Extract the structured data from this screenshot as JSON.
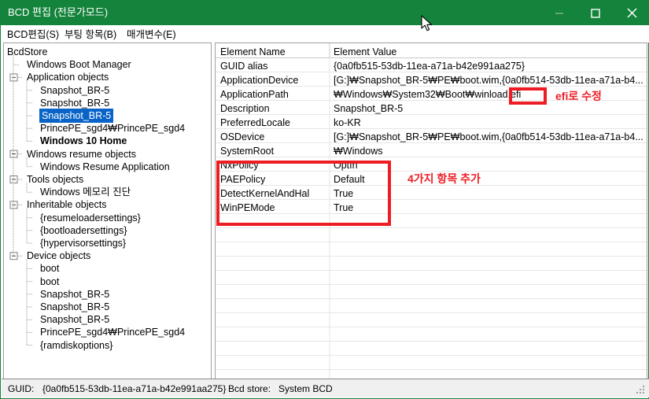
{
  "window": {
    "title": "BCD 편집 (전문가모드)",
    "accent_color": "#14833b",
    "controls": {
      "minimize": "minimize-icon",
      "maximize": "maximize-icon",
      "close": "close-icon"
    }
  },
  "menubar": {
    "items": [
      {
        "label": "BCD편집(S)"
      },
      {
        "label": "부팅 항목(B)"
      },
      {
        "label": "매개변수(E)"
      }
    ]
  },
  "tree": {
    "root": "BcdStore",
    "nodes": [
      {
        "label": "BcdStore",
        "depth": 0,
        "expander": "none",
        "bold": false,
        "selected": false
      },
      {
        "label": "Windows Boot Manager",
        "depth": 1,
        "expander": "none",
        "bold": false,
        "selected": false
      },
      {
        "label": "Application objects",
        "depth": 1,
        "expander": "minus",
        "bold": false,
        "selected": false
      },
      {
        "label": "Snapshot_BR-5",
        "depth": 2,
        "expander": "none",
        "bold": false,
        "selected": false
      },
      {
        "label": "Snapshot_BR-5",
        "depth": 2,
        "expander": "none",
        "bold": false,
        "selected": false
      },
      {
        "label": "Snapshot_BR-5",
        "depth": 2,
        "expander": "none",
        "bold": false,
        "selected": true
      },
      {
        "label": "PrincePE_sgd4₩PrincePE_sgd4",
        "depth": 2,
        "expander": "none",
        "bold": false,
        "selected": false
      },
      {
        "label": "Windows 10 Home",
        "depth": 2,
        "expander": "none",
        "bold": true,
        "selected": false
      },
      {
        "label": "Windows resume objects",
        "depth": 1,
        "expander": "minus",
        "bold": false,
        "selected": false
      },
      {
        "label": "Windows Resume Application",
        "depth": 2,
        "expander": "none",
        "bold": false,
        "selected": false
      },
      {
        "label": "Tools objects",
        "depth": 1,
        "expander": "minus",
        "bold": false,
        "selected": false
      },
      {
        "label": "Windows 메모리 진단",
        "depth": 2,
        "expander": "none",
        "bold": false,
        "selected": false
      },
      {
        "label": "Inheritable objects",
        "depth": 1,
        "expander": "minus",
        "bold": false,
        "selected": false
      },
      {
        "label": "{resumeloadersettings}",
        "depth": 2,
        "expander": "none",
        "bold": false,
        "selected": false
      },
      {
        "label": "{bootloadersettings}",
        "depth": 2,
        "expander": "none",
        "bold": false,
        "selected": false
      },
      {
        "label": "{hypervisorsettings}",
        "depth": 2,
        "expander": "none",
        "bold": false,
        "selected": false
      },
      {
        "label": "Device objects",
        "depth": 1,
        "expander": "minus",
        "bold": false,
        "selected": false
      },
      {
        "label": "boot",
        "depth": 2,
        "expander": "none",
        "bold": false,
        "selected": false
      },
      {
        "label": "boot",
        "depth": 2,
        "expander": "none",
        "bold": false,
        "selected": false
      },
      {
        "label": "Snapshot_BR-5",
        "depth": 2,
        "expander": "none",
        "bold": false,
        "selected": false
      },
      {
        "label": "Snapshot_BR-5",
        "depth": 2,
        "expander": "none",
        "bold": false,
        "selected": false
      },
      {
        "label": "Snapshot_BR-5",
        "depth": 2,
        "expander": "none",
        "bold": false,
        "selected": false
      },
      {
        "label": "PrincePE_sgd4₩PrincePE_sgd4",
        "depth": 2,
        "expander": "none",
        "bold": false,
        "selected": false
      },
      {
        "label": "{ramdiskoptions}",
        "depth": 2,
        "expander": "none",
        "bold": false,
        "selected": false
      }
    ]
  },
  "list": {
    "columns": [
      {
        "label": "Element Name"
      },
      {
        "label": "Element Value"
      }
    ],
    "rows": [
      {
        "name": "GUID alias",
        "value": "{0a0fb515-53db-11ea-a71a-b42e991aa275}"
      },
      {
        "name": "ApplicationDevice",
        "value": "[G:]₩Snapshot_BR-5₩PE₩boot.wim,{0a0fb514-53db-11ea-a71a-b4..."
      },
      {
        "name": "ApplicationPath",
        "value": "₩Windows₩System32₩Boot₩winload.efi"
      },
      {
        "name": "Description",
        "value": "Snapshot_BR-5"
      },
      {
        "name": "PreferredLocale",
        "value": "ko-KR"
      },
      {
        "name": "OSDevice",
        "value": "[G:]₩Snapshot_BR-5₩PE₩boot.wim,{0a0fb514-53db-11ea-a71a-b4..."
      },
      {
        "name": "SystemRoot",
        "value": "₩Windows"
      },
      {
        "name": "NxPolicy",
        "value": "OptIn"
      },
      {
        "name": "PAEPolicy",
        "value": "Default"
      },
      {
        "name": "DetectKernelAndHal",
        "value": "True"
      },
      {
        "name": "WinPEMode",
        "value": "True"
      }
    ]
  },
  "annotations": {
    "color": "#ee1d23",
    "efi_note": "efi로 수정",
    "four_items_note": "4가지 항목 추가",
    "efi_highlight_text": "efi"
  },
  "statusbar": {
    "guid_label": "GUID:",
    "guid_value": "{0a0fb515-53db-11ea-a71a-b42e991aa275}",
    "store_label": "Bcd store:",
    "store_value": "System BCD"
  }
}
